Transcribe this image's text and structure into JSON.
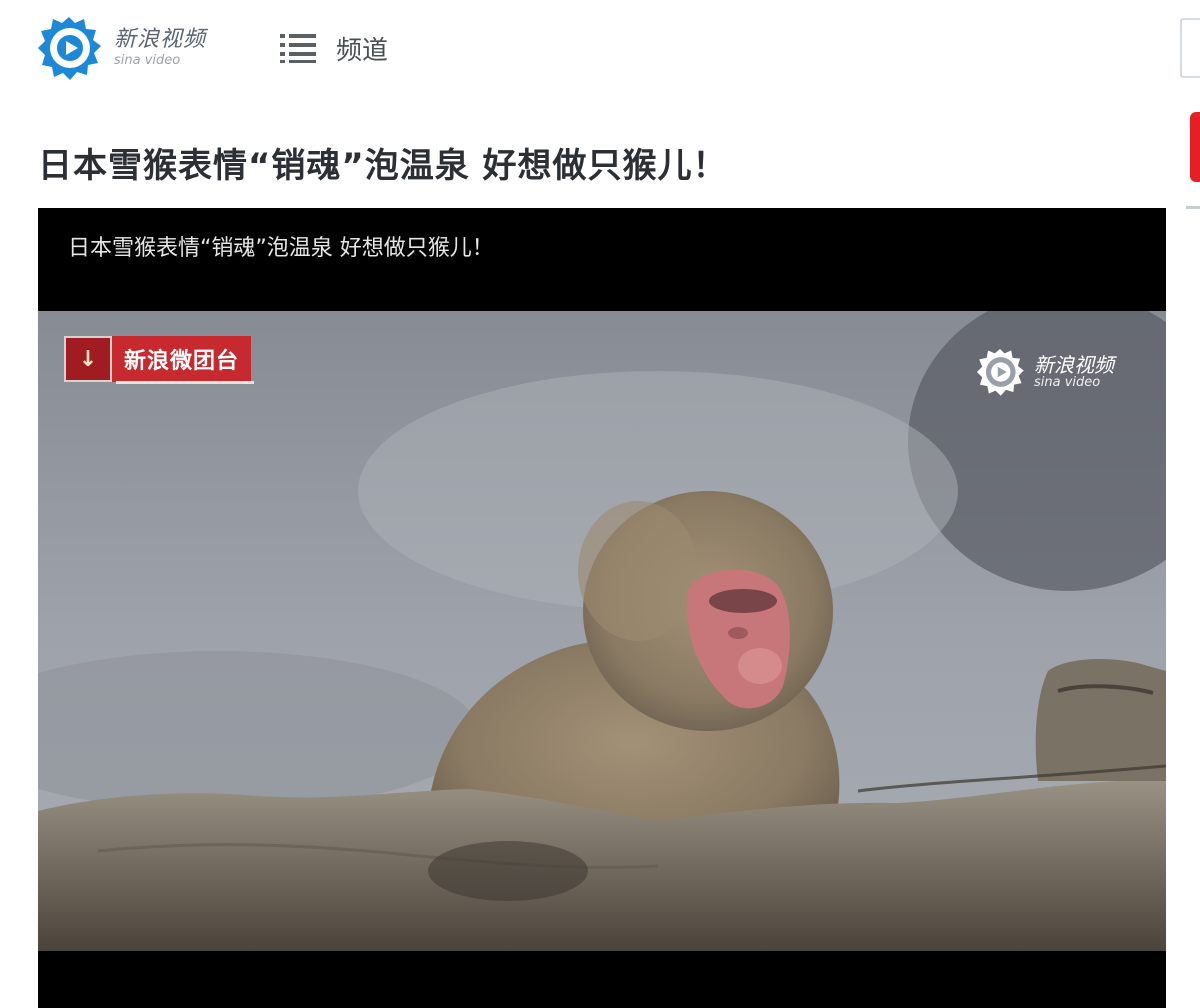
{
  "header": {
    "logo": {
      "cn": "新浪视频",
      "en": "sina video",
      "icon": "sina-eye-play-icon",
      "color": "#1e88d8"
    },
    "channel": {
      "label": "频道",
      "icon": "menu-list-icon"
    }
  },
  "article": {
    "title": "日本雪猴表情“销魂”泡温泉 好想做只猴儿！"
  },
  "player": {
    "video_title": "日本雪猴表情“销魂”泡温泉 好想做只猴儿！",
    "broadcast_badge": {
      "icon_char": "↓",
      "label": "新浪微团台",
      "color": "#c72a2e"
    },
    "watermark": {
      "cn": "新浪视频",
      "en": "sina video",
      "icon": "sina-eye-play-icon"
    },
    "frame_description_icon": "snow-monkey-hot-spring-video-frame"
  },
  "colors": {
    "accent_blue": "#1e88d8",
    "brand_red": "#e51f25",
    "title_text": "#2c2f33"
  }
}
